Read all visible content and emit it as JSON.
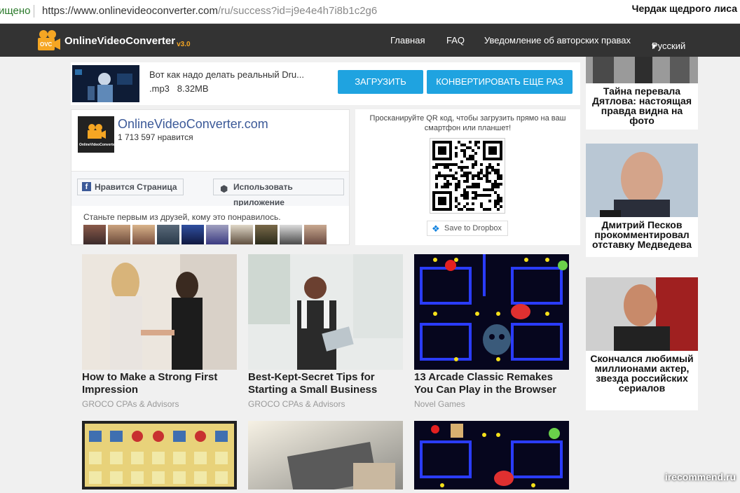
{
  "browser": {
    "security_text": "ищено",
    "url_host": "https://www.onlinevideoconverter.com",
    "url_path": "/ru/success?id=j9e4e4h7i8b1c2g6",
    "window_title": "Чердак щедрого лиса"
  },
  "header": {
    "brand": "OnlineVideoConverter",
    "version": "v3.0",
    "logo_text": "OVC",
    "nav": [
      "Главная",
      "FAQ",
      "Уведомление об авторских правах",
      "Русский"
    ]
  },
  "file": {
    "name": "Вот как надо делать реальный Dru...",
    "ext": ".mp3",
    "size": "8.32MB",
    "download_label": "ЗАГРУЗИТЬ",
    "convert_again_label": "КОНВЕРТИРОВАТЬ ЕЩЕ РАЗ"
  },
  "facebook": {
    "page_name": "OnlineVideoConverter.com",
    "likes": "1 713 597 нравится",
    "like_button": "Нравится Страница",
    "app_button": "Использовать приложение",
    "friends_text": "Станьте первым из друзей, кому это понравилось.",
    "pic_label": "OnlineVideoConverter"
  },
  "qr": {
    "text": "Просканируйте QR код, чтобы загрузить прямо на ваш смартфон или планшет!",
    "dropbox_label": "Save to Dropbox"
  },
  "cards": [
    {
      "title": "How to Make a Strong First Impression",
      "source": "GROCO CPAs & Advisors"
    },
    {
      "title": "Best-Kept-Secret Tips for Starting a Small Business",
      "source": "GROCO CPAs & Advisors"
    },
    {
      "title": "13 Arcade Classic Remakes You Can Play in the Browser",
      "source": "Novel Games"
    }
  ],
  "sidebar": [
    {
      "title": "Тайна перевала Дятлова: настоящая правда видна на фото"
    },
    {
      "title": "Дмитрий Песков прокомментировал отставку Медведева"
    },
    {
      "title": "Скончался любимый миллионами актер, звезда российских сериалов"
    }
  ],
  "watermark": "irecommend.ru",
  "colors": {
    "accent": "#1fa3e0",
    "nav_bg": "#333333",
    "fb_blue": "#3b5998",
    "logo_orange": "#f5a623"
  }
}
